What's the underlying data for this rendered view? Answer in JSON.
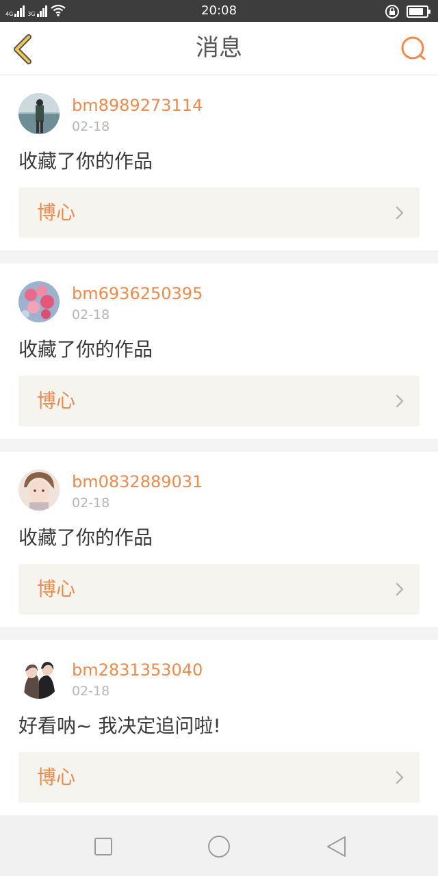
{
  "status_bar": {
    "time": "20:08",
    "network1": "4G",
    "network2": "3G"
  },
  "header": {
    "title": "消息",
    "back_icon": "chevron-left-icon",
    "search_icon": "search-icon"
  },
  "colors": {
    "accent": "#ee8a4c",
    "back_arrow": "#f2c94c",
    "card_bg": "#f5f4ef"
  },
  "messages": [
    {
      "username": "bm8989273114",
      "date": "02-18",
      "text": "收藏了你的作品",
      "work": "博心"
    },
    {
      "username": "bm6936250395",
      "date": "02-18",
      "text": "收藏了你的作品",
      "work": "博心"
    },
    {
      "username": "bm0832889031",
      "date": "02-18",
      "text": "收藏了你的作品",
      "work": "博心"
    },
    {
      "username": "bm2831353040",
      "date": "02-18",
      "text": "好看呐~ 我决定追问啦!",
      "work": "博心"
    }
  ]
}
